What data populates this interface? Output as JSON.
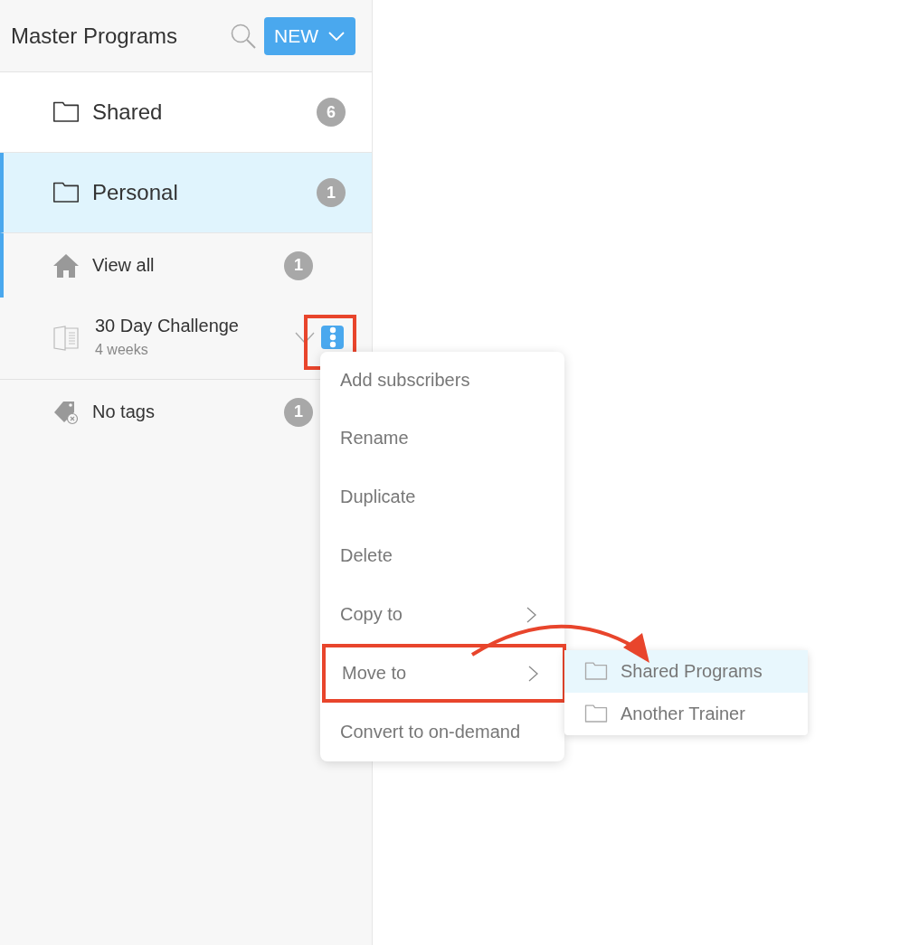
{
  "header": {
    "title": "Master Programs",
    "new_button": "NEW"
  },
  "folders": [
    {
      "name": "Shared",
      "count": "6",
      "selected": false
    },
    {
      "name": "Personal",
      "count": "1",
      "selected": true,
      "children": [
        {
          "kind": "view_all",
          "name": "View all",
          "count": "1",
          "selected": true
        },
        {
          "kind": "program",
          "name": "30 Day Challenge",
          "subtitle": "4 weeks",
          "selected": false,
          "menu_outlined": true
        },
        {
          "kind": "no_tags",
          "name": "No tags",
          "count": "1",
          "selected": false
        }
      ]
    }
  ],
  "context_menu": {
    "items": [
      {
        "label": "Add subscribers",
        "submenu": false,
        "outlined": false
      },
      {
        "label": "Rename",
        "submenu": false,
        "outlined": false
      },
      {
        "label": "Duplicate",
        "submenu": false,
        "outlined": false
      },
      {
        "label": "Delete",
        "submenu": false,
        "outlined": false
      },
      {
        "label": "Copy to",
        "submenu": true,
        "outlined": false
      },
      {
        "label": "Move to",
        "submenu": true,
        "outlined": true
      },
      {
        "label": "Convert to on-demand",
        "submenu": false,
        "outlined": false
      }
    ]
  },
  "submenu": {
    "items": [
      {
        "label": "Shared Programs",
        "selected": true
      },
      {
        "label": "Another Trainer",
        "selected": false
      }
    ]
  },
  "annotation_arrow": true
}
